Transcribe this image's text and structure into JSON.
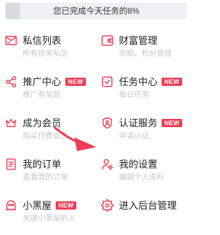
{
  "progress": {
    "text": "您已完成今天任务的8%",
    "value": 0.08
  },
  "accent": "#ee3e57",
  "items": [
    {
      "title": "私信列表",
      "sub": "所有往来私信",
      "icon": "mail-icon",
      "badge": ""
    },
    {
      "title": "财富管理",
      "sub": "余额、积分管理",
      "icon": "wallet-icon",
      "badge": ""
    },
    {
      "title": "推广中心",
      "sub": "推广有奖励",
      "icon": "share-icon",
      "badge": "NEW"
    },
    {
      "title": "任务中心",
      "sub": "每日任务",
      "icon": "task-check-icon",
      "badge": "NEW"
    },
    {
      "title": "成为会员",
      "sub": "购买付费会员",
      "icon": "crown-icon",
      "badge": ""
    },
    {
      "title": "认证服务",
      "sub": "申请认证",
      "icon": "verify-shield-icon",
      "badge": "NEW"
    },
    {
      "title": "我的订单",
      "sub": "查看我的订单",
      "icon": "order-icon",
      "badge": ""
    },
    {
      "title": "我的设置",
      "sub": "编辑个人资料",
      "icon": "user-settings-icon",
      "badge": ""
    },
    {
      "title": "小黑屋",
      "sub": "关进小黑屋的人",
      "icon": "ghost-icon",
      "badge": "NEW"
    },
    {
      "title": "进入后台管理",
      "sub": "",
      "icon": "gear-icon",
      "badge": ""
    }
  ]
}
